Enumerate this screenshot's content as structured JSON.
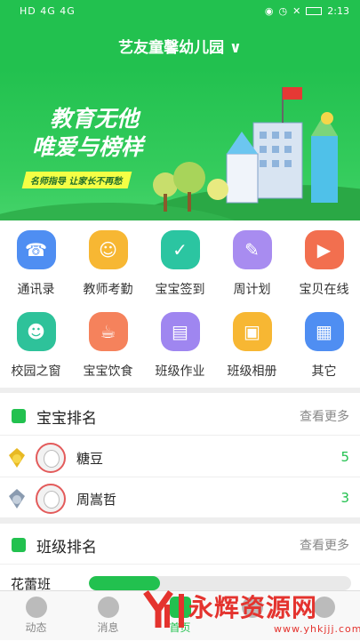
{
  "status": {
    "left": "HD 4G 4G",
    "time": "2:13"
  },
  "header": {
    "title": "艺友童馨幼儿园 ∨"
  },
  "banner": {
    "line1": "教育无他",
    "line2": "唯爱与榜样",
    "tag": "名师指导 让家长不再愁"
  },
  "menu": [
    {
      "label": "通讯录",
      "color": "#4f8ef2",
      "icon": "contacts-icon",
      "glyph": "☎"
    },
    {
      "label": "教师考勤",
      "color": "#f7b733",
      "icon": "teacher-icon",
      "glyph": "☺"
    },
    {
      "label": "宝宝签到",
      "color": "#2bc5a1",
      "icon": "calendar-check-icon",
      "glyph": "✓"
    },
    {
      "label": "周计划",
      "color": "#a88cf0",
      "icon": "edit-icon",
      "glyph": "✎"
    },
    {
      "label": "宝贝在线",
      "color": "#f26f4f",
      "icon": "video-icon",
      "glyph": "▶"
    },
    {
      "label": "校园之窗",
      "color": "#2ec29a",
      "icon": "family-icon",
      "glyph": "☻"
    },
    {
      "label": "宝宝饮食",
      "color": "#f5825c",
      "icon": "food-icon",
      "glyph": "☕"
    },
    {
      "label": "班级作业",
      "color": "#9f86f0",
      "icon": "book-icon",
      "glyph": "▤"
    },
    {
      "label": "班级相册",
      "color": "#f7b733",
      "icon": "photo-icon",
      "glyph": "▣"
    },
    {
      "label": "其它",
      "color": "#4f8ef2",
      "icon": "grid-icon",
      "glyph": "▦"
    }
  ],
  "baby_rank": {
    "title": "宝宝排名",
    "more": "查看更多",
    "rows": [
      {
        "name": "糖豆",
        "score": "5",
        "medal": "gold-medal-icon"
      },
      {
        "name": "周嵩哲",
        "score": "3",
        "medal": "silver-medal-icon"
      }
    ]
  },
  "class_rank": {
    "title": "班级排名",
    "more": "查看更多",
    "rows": [
      {
        "name": "花蕾班",
        "progress": 0.27
      }
    ]
  },
  "tabs": [
    {
      "label": "动态"
    },
    {
      "label": "消息"
    },
    {
      "label": "首页"
    },
    {
      "label": ""
    },
    {
      "label": ""
    }
  ],
  "watermark": {
    "text": "永辉资源网",
    "url": "www.yhkjjj.com"
  },
  "colors": {
    "primary": "#22c14f"
  }
}
